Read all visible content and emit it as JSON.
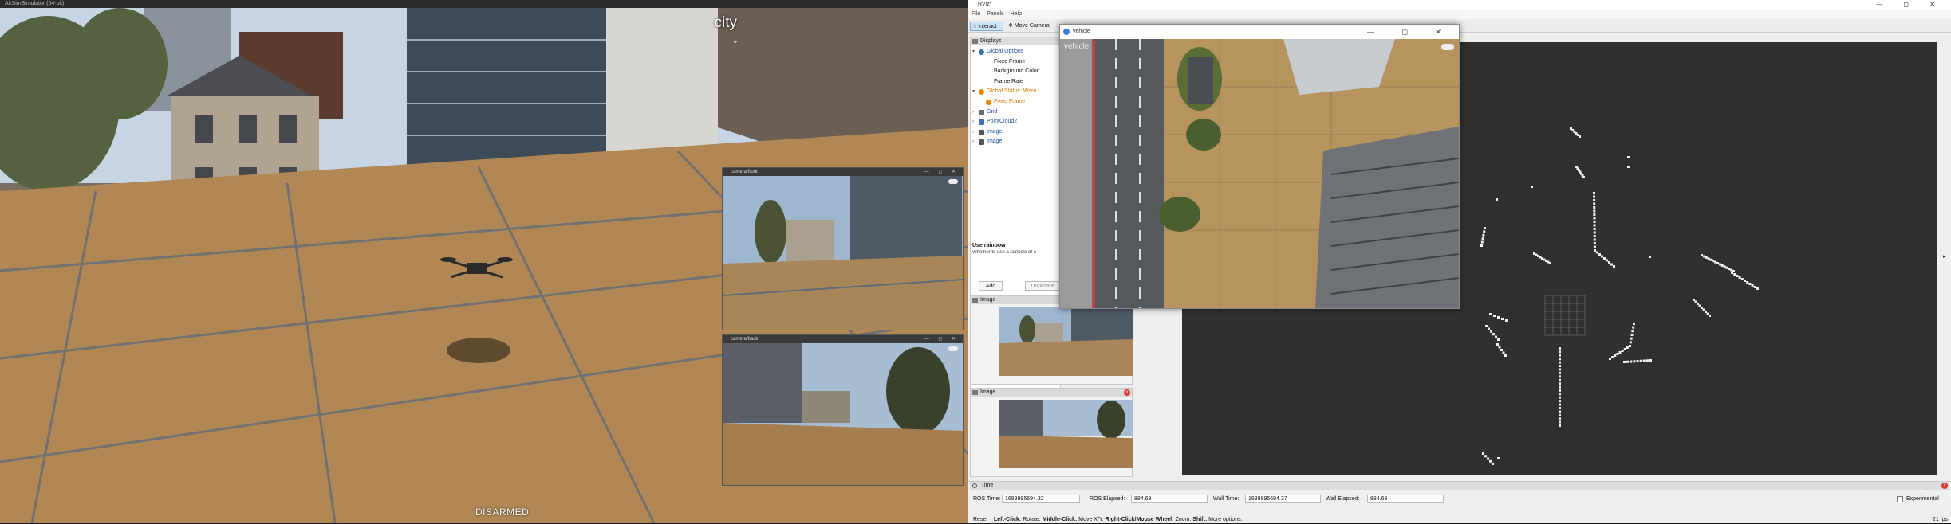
{
  "simulator": {
    "window_title": "AirSimSimulator (64-bit)",
    "location_label": "city",
    "location_chevron": "⌄",
    "status_text": "DISARMED",
    "subwindow_front": {
      "title": "camera/front"
    },
    "subwindow_back": {
      "title": "camera/back"
    },
    "subwindow_controls": "— ◻ ✕"
  },
  "rviz": {
    "window_title": "RViz*",
    "window_controls": "— ◻ ✕",
    "menu": [
      "File",
      "Panels",
      "Help"
    ],
    "toolbar": {
      "interact": "Interact",
      "move_camera": "Move Camera"
    },
    "displays": {
      "header": "Displays",
      "rows": [
        {
          "arrow": "▾",
          "icon": "gear-icon",
          "label": "Global Options",
          "color": "#2255aa",
          "indent": 0
        },
        {
          "arrow": "",
          "icon": "",
          "label": "Fixed Frame",
          "color": "#111111",
          "indent": 1
        },
        {
          "arrow": "",
          "icon": "",
          "label": "Background Color",
          "color": "#111111",
          "indent": 1
        },
        {
          "arrow": "",
          "icon": "",
          "label": "Frame Rate",
          "color": "#111111",
          "indent": 1
        },
        {
          "arrow": "▾",
          "icon": "warning-icon",
          "label": "Global Status: Warn",
          "color": "#d68100",
          "indent": 0
        },
        {
          "arrow": "",
          "icon": "warning-icon",
          "label": "Fixed Frame",
          "color": "#d68100",
          "indent": 1
        },
        {
          "arrow": "›",
          "icon": "grid-icon",
          "label": "Grid",
          "color": "#2255aa",
          "indent": 0
        },
        {
          "arrow": "›",
          "icon": "pointcloud-icon",
          "label": "PointCloud2",
          "color": "#2255aa",
          "indent": 0
        },
        {
          "arrow": "›",
          "icon": "image-icon",
          "label": "Image",
          "color": "#2255aa",
          "indent": 0
        },
        {
          "arrow": "›",
          "icon": "image-icon",
          "label": "Image",
          "color": "#2255aa",
          "indent": 0
        }
      ],
      "tip_title": "Use rainbow",
      "tip_description": "Whether to use a rainbow of c",
      "add_button": "Add",
      "duplicate_button": "Duplicate"
    },
    "image_panels": [
      {
        "title": "Image"
      },
      {
        "title": "Image"
      }
    ],
    "vehicle_window": {
      "title": "vehicle",
      "overlay_label": "vehicle",
      "controls": "— ◻ ✕"
    },
    "time": {
      "header": "Time",
      "ros_time_label": "ROS Time:",
      "ros_time_value": "1689995694.32",
      "ros_elapsed_label": "ROS Elapsed:",
      "ros_elapsed_value": "884.69",
      "wall_time_label": "Wall Time:",
      "wall_time_value": "1689995694.37",
      "wall_elapsed_label": "Wall Elapsed:",
      "wall_elapsed_value": "884.69",
      "experimental_label": "Experimental"
    },
    "status_bar": {
      "reset": "Reset",
      "left_click_key": "Left-Click:",
      "left_click_action": "Rotate.",
      "middle_click_key": "Middle-Click:",
      "middle_click_action": "Move X/Y.",
      "right_click_key": "Right-Click/Mouse Wheel:",
      "right_click_action": "Zoom.",
      "shift_key": "Shift:",
      "shift_action": "More options.",
      "fps": "21 fps"
    }
  },
  "colors": {
    "interact_bg": "#cfe3f7",
    "warn": "#d68100",
    "link_blue": "#2255aa",
    "viewport_bg": "#303030"
  }
}
